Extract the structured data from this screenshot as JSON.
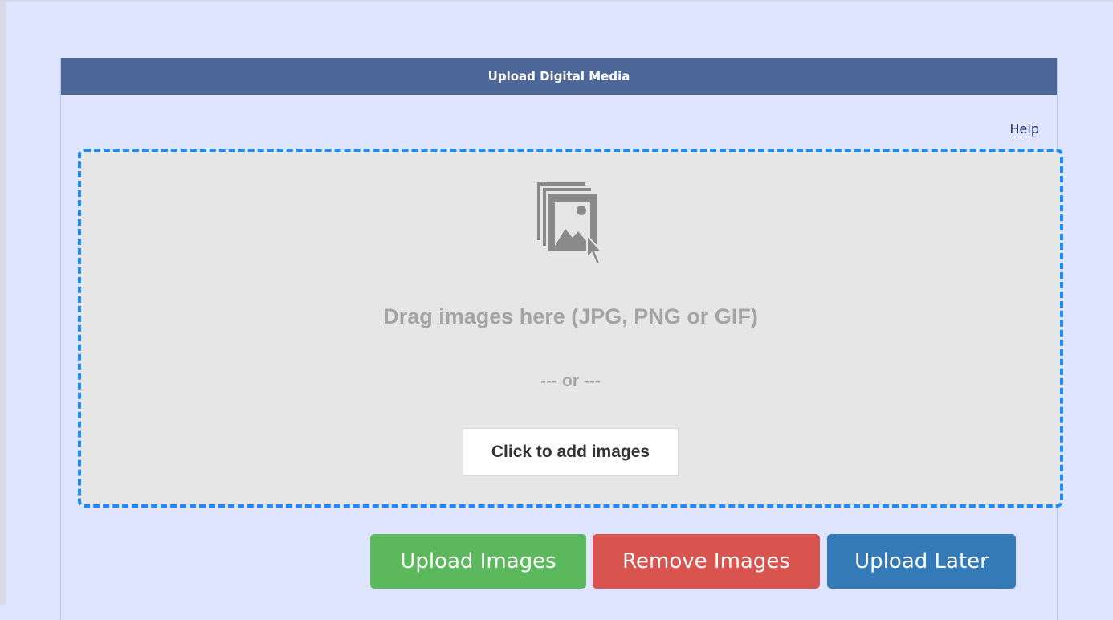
{
  "panel": {
    "title": "Upload Digital Media",
    "help_label": "Help"
  },
  "dropzone": {
    "icon": "image-stack-cursor-icon",
    "instruction": "Drag images here (JPG, PNG or GIF)",
    "separator": "--- or ---",
    "add_button_label": "Click to add images"
  },
  "actions": {
    "upload_label": "Upload Images",
    "remove_label": "Remove Images",
    "later_label": "Upload Later"
  },
  "colors": {
    "page_background": "#dfe4ff",
    "header_background": "#4c6798",
    "dropzone_border": "#1a8cff",
    "dropzone_background": "#e6e6e6",
    "upload_button": "#5cb85c",
    "remove_button": "#d9534f",
    "later_button": "#337ab7"
  }
}
